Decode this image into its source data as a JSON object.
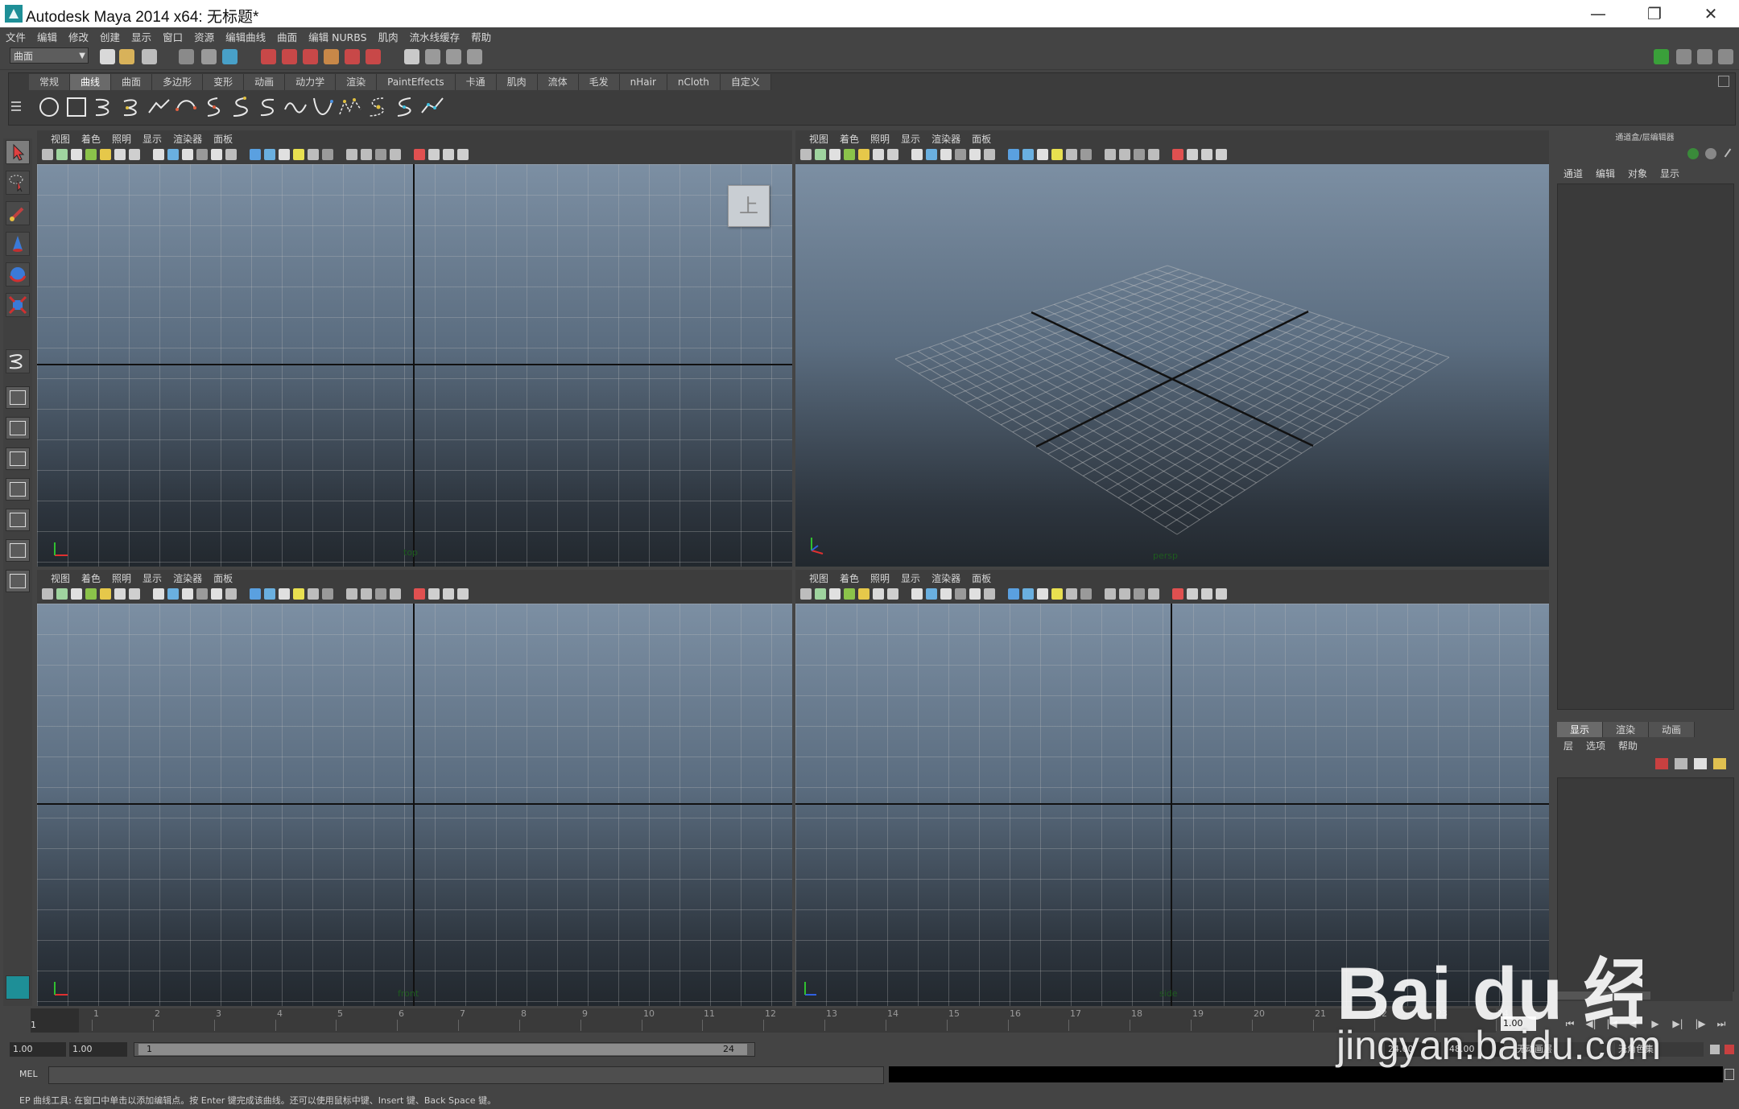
{
  "window": {
    "title": "Autodesk Maya 2014 x64: 无标题*",
    "controls": [
      "minimize",
      "restore",
      "close"
    ]
  },
  "menubar": [
    "文件",
    "编辑",
    "修改",
    "创建",
    "显示",
    "窗口",
    "资源",
    "编辑曲线",
    "曲面",
    "编辑 NURBS",
    "肌肉",
    "流水线缓存",
    "帮助"
  ],
  "statusline": {
    "mode": "曲面"
  },
  "shelf": {
    "tabs": [
      "常规",
      "曲线",
      "曲面",
      "多边形",
      "变形",
      "动画",
      "动力学",
      "渲染",
      "PaintEffects",
      "卡通",
      "肌肉",
      "流体",
      "毛发",
      "nHair",
      "nCloth",
      "自定义"
    ],
    "active_tab": "曲线",
    "icons": [
      "circle-icon",
      "square-icon",
      "cv-curve-icon",
      "ep-curve-icon",
      "pencil-curve-icon",
      "arc-icon",
      "arc-3pt-icon",
      "bezier-icon",
      "text-curve-icon",
      "spiral-icon",
      "helix-icon",
      "attach-curve-icon",
      "detach-curve-icon",
      "fillet-curve-icon",
      "rebuild-curve-icon"
    ]
  },
  "panel_menu": [
    "视图",
    "着色",
    "照明",
    "显示",
    "渲染器",
    "面板"
  ],
  "viewports": [
    {
      "id": "top",
      "camera": "top",
      "viewcube": "上"
    },
    {
      "id": "persp",
      "camera": "persp"
    },
    {
      "id": "front",
      "camera": "front"
    },
    {
      "id": "side",
      "camera": "side"
    }
  ],
  "channel_box": {
    "header": "通道盒/层编辑器",
    "menu": [
      "通道",
      "编辑",
      "对象",
      "显示"
    ]
  },
  "layer_editor": {
    "tabs": [
      "显示",
      "渲染",
      "动画"
    ],
    "active_tab": "显示",
    "menu": [
      "层",
      "选项",
      "帮助"
    ]
  },
  "timeline": {
    "ticks": [
      "1",
      "2",
      "3",
      "4",
      "5",
      "6",
      "7",
      "8",
      "9",
      "10",
      "11",
      "12",
      "13",
      "14",
      "15",
      "16",
      "17",
      "18",
      "19",
      "20",
      "21",
      "22",
      "23",
      "24"
    ],
    "start_label": "1",
    "current_frame": "1.00",
    "playback": [
      "go-start-icon",
      "step-back-key-icon",
      "step-back-frame-icon",
      "play-back-icon",
      "play-forward-icon",
      "step-forward-frame-icon",
      "step-forward-key-icon",
      "go-end-icon"
    ]
  },
  "range": {
    "start_time": "1.00",
    "playback_start": "1.00",
    "range_start": "1",
    "range_end": "24",
    "playback_end": "24.00",
    "end_time": "48.00",
    "anim_layer": "无动画层",
    "char_set": "无角色集"
  },
  "command": {
    "label": "MEL",
    "input": "",
    "result": ""
  },
  "helpline": "EP 曲线工具: 在窗口中单击以添加编辑点。按 Enter 键完成该曲线。还可以使用鼠标中键、Insert 键、Back Space 键。",
  "watermark": {
    "brand": "Bai du 经验",
    "url": "jingyan.baidu.com"
  }
}
